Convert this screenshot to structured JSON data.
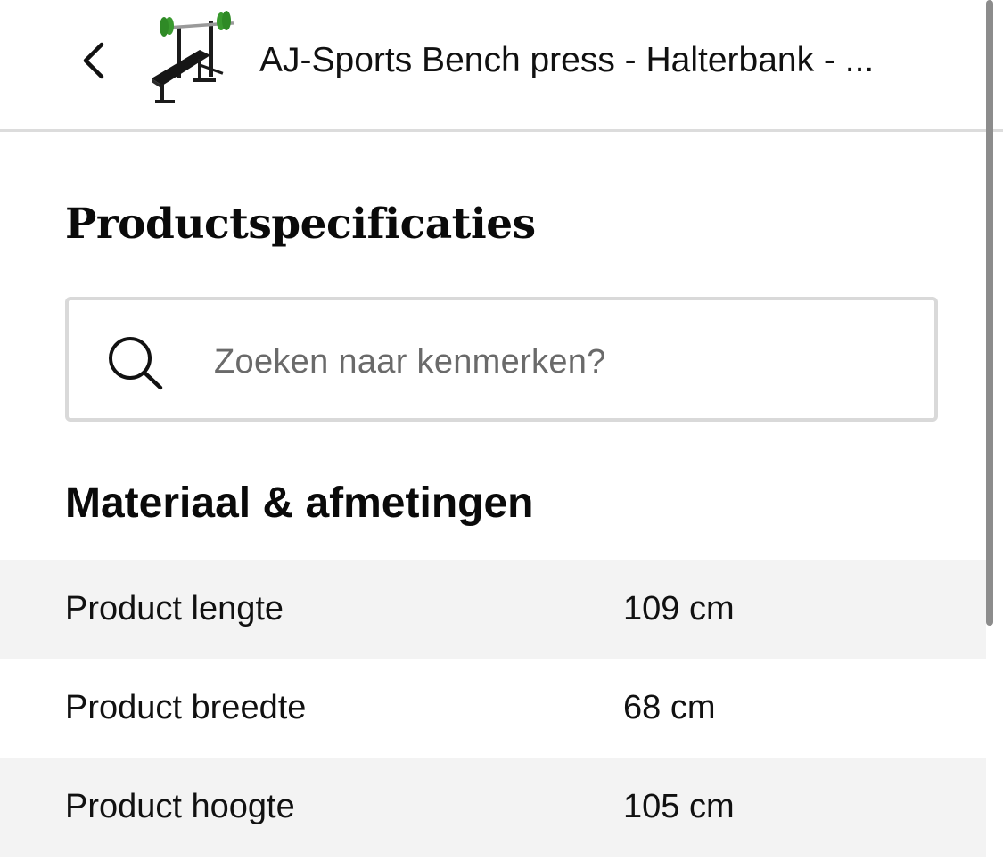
{
  "header": {
    "back_icon": "chevron-left-icon",
    "thumbnail_icon": "bench-press-product-image",
    "title": "AJ-Sports Bench press - Halterbank - ..."
  },
  "page": {
    "section_title": "Productspecificaties"
  },
  "search": {
    "icon": "search-icon",
    "value": "",
    "placeholder": "Zoeken naar kenmerken?"
  },
  "specs": {
    "group_title": "Materiaal & afmetingen",
    "rows": [
      {
        "label": "Product lengte",
        "value": "109 cm"
      },
      {
        "label": "Product breedte",
        "value": "68 cm"
      },
      {
        "label": "Product hoogte",
        "value": "105 cm"
      }
    ]
  },
  "colors": {
    "accent_green": "#3a9a2f",
    "row_shade": "#f3f3f3",
    "border": "#d9d9d9"
  }
}
